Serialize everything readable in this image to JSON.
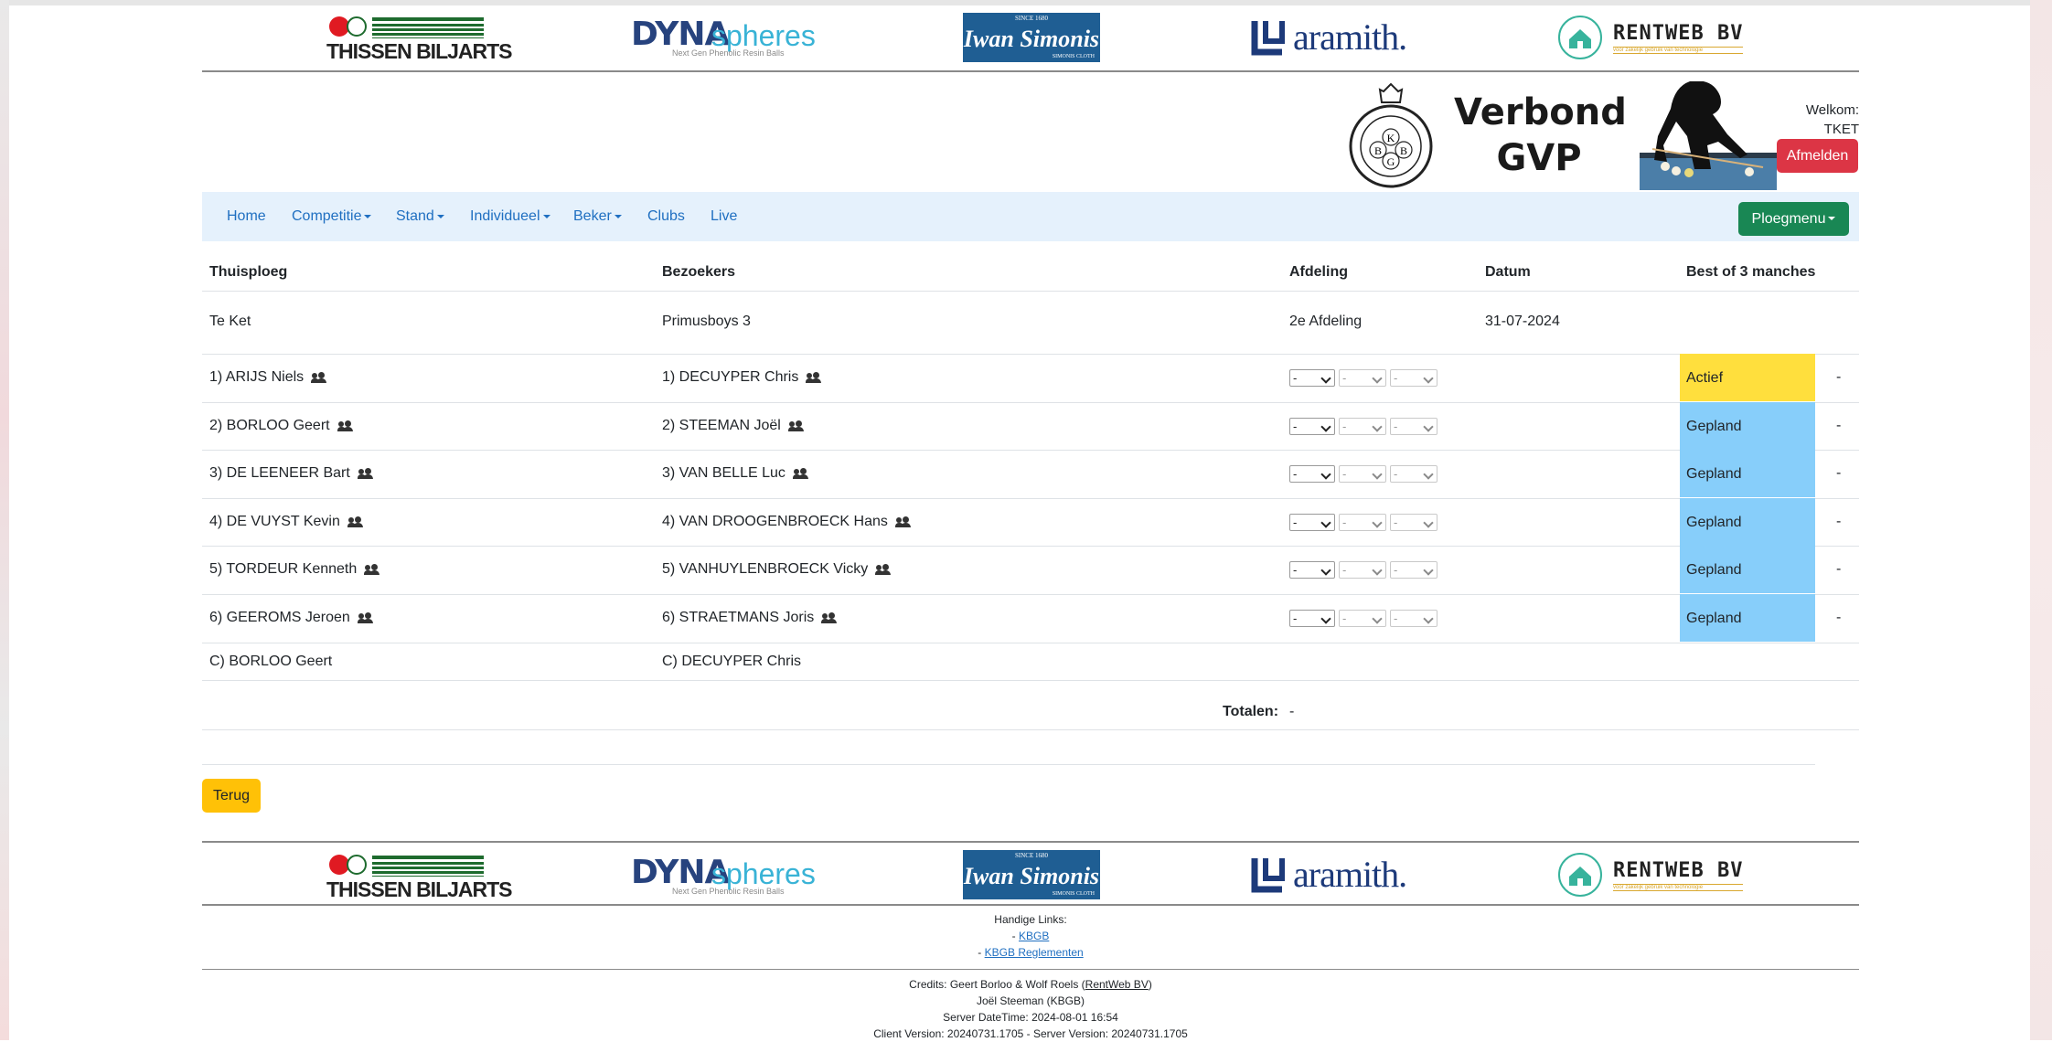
{
  "sponsors": {
    "thissen": "THISSEN BILJARTS",
    "dyna_main": "DYNA",
    "dyna_spheres": "spheres",
    "dyna_tagline": "Next Gen Phenolic Resin Balls",
    "simonis_since": "SINCE 1680",
    "simonis_name": "Iwan Simonis",
    "simonis_cloth": "SIMONIS CLOTH",
    "aramith": "aramith.",
    "rentweb": "RENTWEB BV",
    "rentweb_tagline": "voor zakelijk gebruik van technologie"
  },
  "header": {
    "org_line1": "Verbond",
    "org_line2": "GVP",
    "kbgb_letters": [
      "K",
      "B",
      "B",
      "G"
    ],
    "kbgb_ring": "Koninklijke Belgische Biljartbond",
    "welkom": "Welkom:",
    "user": "TKET",
    "logout": "Afmelden"
  },
  "nav": {
    "home": "Home",
    "competitie": "Competitie",
    "stand": "Stand",
    "individueel": "Individueel",
    "beker": "Beker",
    "clubs": "Clubs",
    "live": "Live",
    "ploegmenu": "Ploegmenu"
  },
  "table": {
    "headers": {
      "home": "Thuisploeg",
      "away": "Bezoekers",
      "division": "Afdeling",
      "date": "Datum",
      "format": "Best of 3 manches"
    },
    "match": {
      "home": "Te Ket",
      "away": "Primusboys 3",
      "division": "2e Afdeling",
      "date": "31-07-2024"
    },
    "rows": [
      {
        "home": "1) ARIJS Niels",
        "away": "1) DECUYPER Chris",
        "sel1": "-",
        "sel2": "-",
        "sel3": "-",
        "status": "Actief",
        "status_color": "#ffdf3d",
        "result": "-"
      },
      {
        "home": "2) BORLOO Geert",
        "away": "2) STEEMAN Joël",
        "sel1": "-",
        "sel2": "-",
        "sel3": "-",
        "status": "Gepland",
        "status_color": "#87cefa",
        "result": "-"
      },
      {
        "home": "3) DE LEENEER Bart",
        "away": "3) VAN BELLE Luc",
        "sel1": "-",
        "sel2": "-",
        "sel3": "-",
        "status": "Gepland",
        "status_color": "#87cefa",
        "result": "-"
      },
      {
        "home": "4) DE VUYST Kevin",
        "away": "4) VAN DROOGENBROECK Hans",
        "sel1": "-",
        "sel2": "-",
        "sel3": "-",
        "status": "Gepland",
        "status_color": "#87cefa",
        "result": "-"
      },
      {
        "home": "5) TORDEUR Kenneth",
        "away": "5) VANHUYLENBROECK Vicky",
        "sel1": "-",
        "sel2": "-",
        "sel3": "-",
        "status": "Gepland",
        "status_color": "#87cefa",
        "result": "-"
      },
      {
        "home": "6) GEEROMS Jeroen",
        "away": "6) STRAETMANS Joris",
        "sel1": "-",
        "sel2": "-",
        "sel3": "-",
        "status": "Gepland",
        "status_color": "#87cefa",
        "result": "-"
      }
    ],
    "captains": {
      "home": "C) BORLOO Geert",
      "away": "C) DECUYPER Chris"
    },
    "totals_label": "Totalen:",
    "totals_value": "-"
  },
  "back_button": "Terug",
  "footer": {
    "links_title": "Handige Links:",
    "link_prefix": "- ",
    "link1": "KBGB",
    "link2": "KBGB Reglementen",
    "credits_prefix": "Credits: Geert Borloo & Wolf Roels (",
    "credits_link": "RentWeb BV",
    "credits_suffix": ")",
    "credits_line2": "Joël Steeman (KBGB)",
    "server_time": "Server DateTime: 2024-08-01 16:54",
    "version": "Client Version: 20240731.1705 - Server Version: 20240731.1705"
  },
  "colors": {
    "nav_bg": "#e5f1fc",
    "link": "#1f6fc1",
    "danger": "#dc3545",
    "success": "#198754",
    "warning": "#ffc107"
  },
  "icons": [
    "group-icon",
    "chevron-down-icon",
    "caret-down-icon"
  ]
}
